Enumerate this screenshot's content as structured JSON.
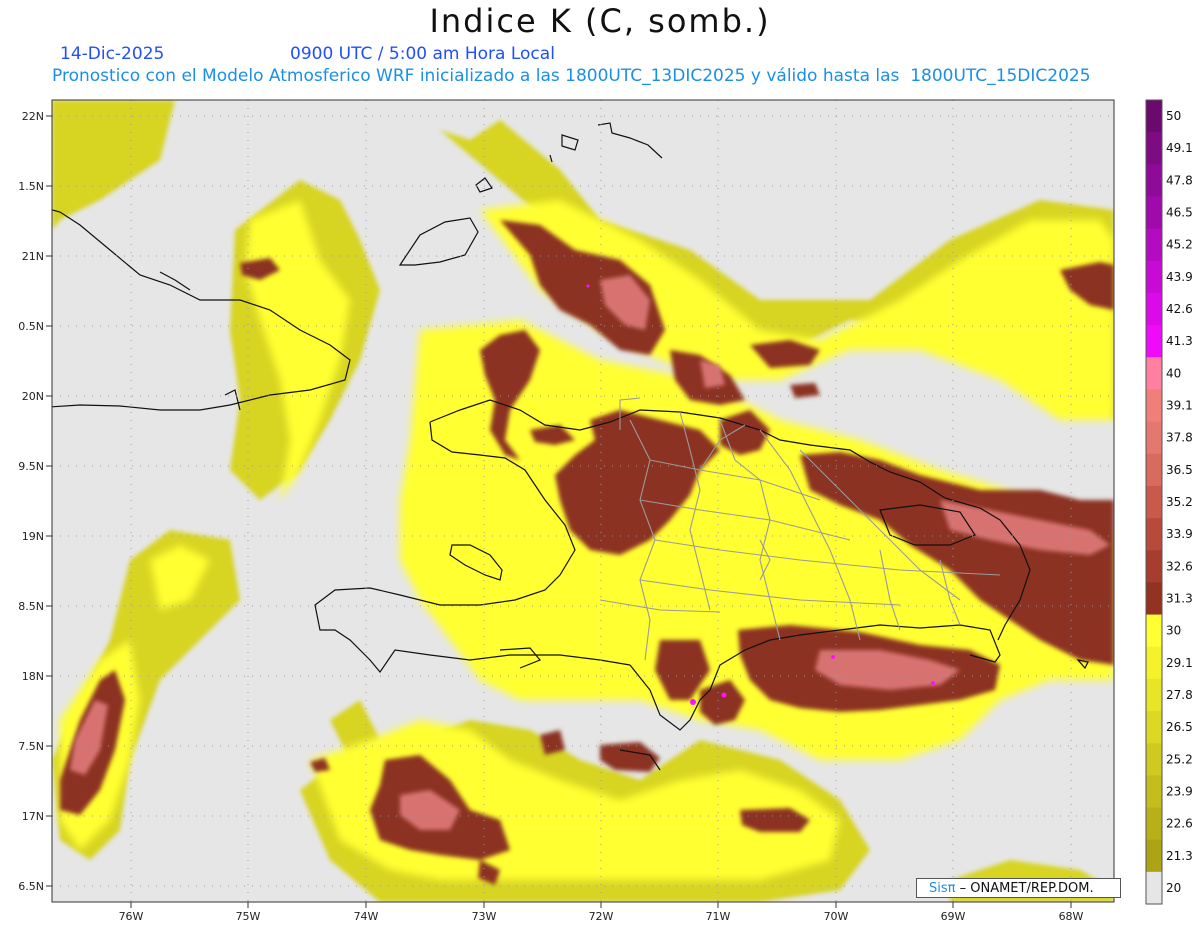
{
  "header": {
    "title": "Indice K (C, somb.)",
    "date": "14-Dic-2025",
    "time": "0900 UTC / 5:00 am Hora Local",
    "description": "Pronostico con el Modelo Atmosferico WRF inicializado a las 1800UTC_13DIC2025 y válido hasta las  1800UTC_15DIC2025"
  },
  "axes": {
    "lat_labels": [
      "22N",
      "1.5N",
      "21N",
      "0.5N",
      "20N",
      "9.5N",
      "19N",
      "8.5N",
      "18N",
      "7.5N",
      "17N",
      "6.5N"
    ],
    "lon_labels": [
      "76W",
      "75W",
      "74W",
      "73W",
      "72W",
      "71W",
      "70W",
      "69W",
      "68W"
    ]
  },
  "colorbar": {
    "labels": [
      "50",
      "49.1",
      "47.8",
      "46.5",
      "45.2",
      "43.9",
      "42.6",
      "41.3",
      "40",
      "39.1",
      "37.8",
      "36.5",
      "35.2",
      "33.9",
      "32.6",
      "31.3",
      "30",
      "29.1",
      "27.8",
      "26.5",
      "25.2",
      "23.9",
      "22.6",
      "21.3",
      "20"
    ],
    "colors": [
      "#6b0a6e",
      "#7e0a84",
      "#8f0a98",
      "#a00aad",
      "#b30ac2",
      "#c80ad6",
      "#dc0aea",
      "#f00afa",
      "#ff80a0",
      "#f07f7a",
      "#e5786e",
      "#d96b5e",
      "#c95a4b",
      "#b84a3c",
      "#a63d2e",
      "#943222",
      "#ffff33",
      "#f5f22c",
      "#e8e528",
      "#dcd824",
      "#d0ca20",
      "#c4bd1c",
      "#b8b018",
      "#aca414",
      "#e6e6e6"
    ]
  },
  "colors": {
    "ocean": "#e6e6e6",
    "low_k": "#d7d421",
    "mid_k": "#ffff33",
    "high_k": "#8c3320",
    "very_high_k": "#e07a7a",
    "extreme_k": "#ff10ff",
    "borders": "#111111",
    "provinces": "#9a9a9a"
  },
  "credit": {
    "logo_text": "Sisπ",
    "text": "– ONAMET/REP.DOM."
  }
}
